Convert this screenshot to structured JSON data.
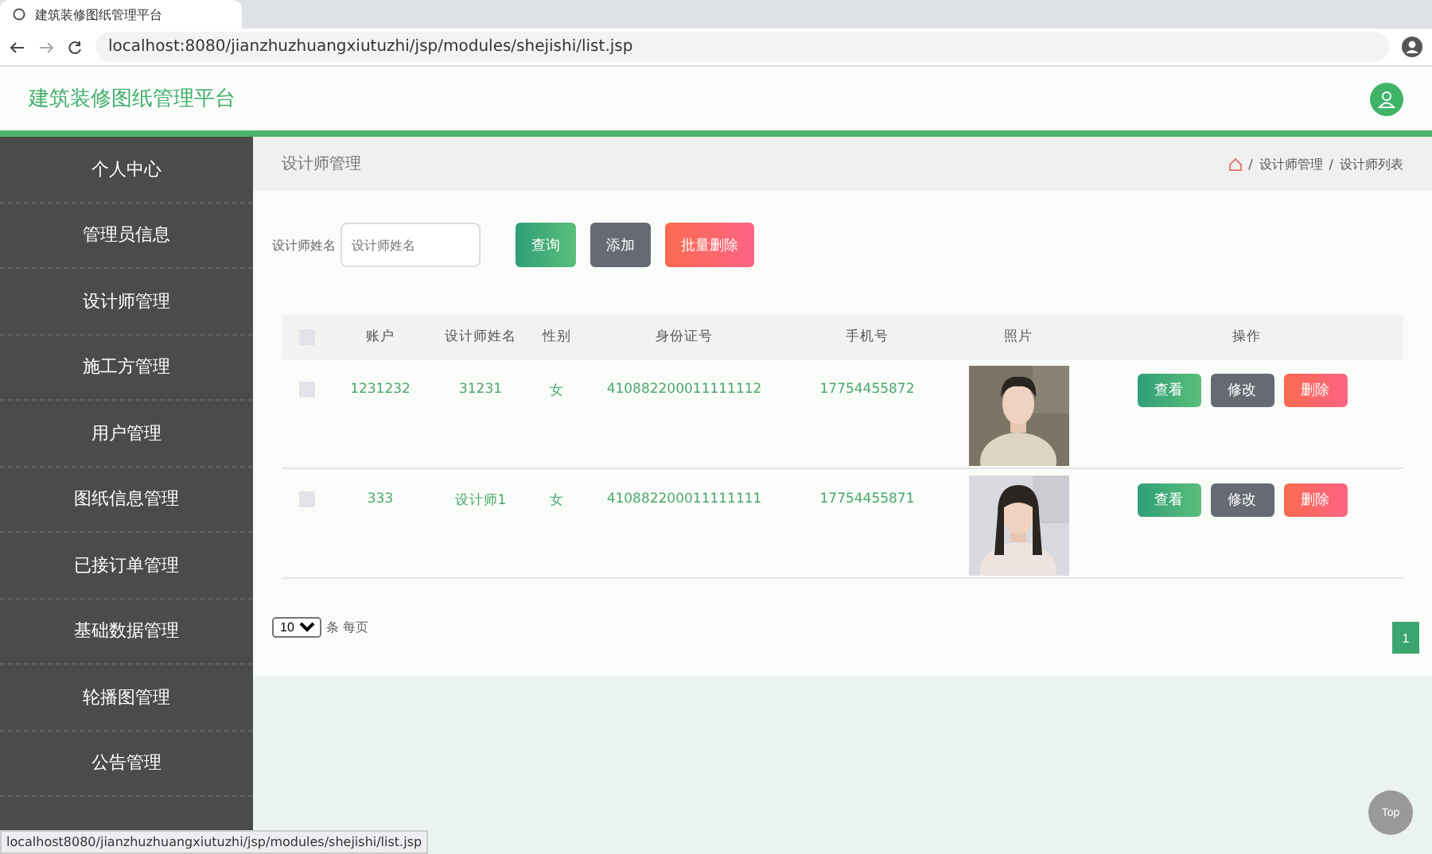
{
  "browser": {
    "tab_title": "建筑装修图纸管理平台",
    "url": "localhost:8080/jianzhuzhuangxiutuzhi/jsp/modules/shejishi/list.jsp",
    "status_url": "localhost8080/jianzhuzhuangxiutuzhi/jsp/modules/shejishi/list.jsp"
  },
  "header": {
    "title": "建筑装修图纸管理平台"
  },
  "sidebar": {
    "items": [
      {
        "label": "个人中心"
      },
      {
        "label": "管理员信息"
      },
      {
        "label": "设计师管理"
      },
      {
        "label": "施工方管理"
      },
      {
        "label": "用户管理"
      },
      {
        "label": "图纸信息管理"
      },
      {
        "label": "已接订单管理"
      },
      {
        "label": "基础数据管理"
      },
      {
        "label": "轮播图管理"
      },
      {
        "label": "公告管理"
      }
    ]
  },
  "page": {
    "title": "设计师管理",
    "breadcrumb": [
      "设计师管理",
      "设计师列表"
    ],
    "separator": "/"
  },
  "search": {
    "label": "设计师姓名",
    "placeholder": "设计师姓名"
  },
  "toolbar": [
    {
      "label": "查询",
      "kind": "primary"
    },
    {
      "label": "添加",
      "kind": "secondary"
    },
    {
      "label": "批量删除",
      "kind": "danger"
    }
  ],
  "table": {
    "header_checked": false,
    "columns": [
      "账户",
      "设计师姓名",
      "性别",
      "身份证号",
      "手机号",
      "照片",
      "操作"
    ],
    "rows": [
      {
        "checked": false,
        "cells": [
          "1231232",
          "31231",
          "女",
          "410882200011111112",
          "17754455872"
        ],
        "actions": [
          {
            "label": "查看",
            "kind": "primary"
          },
          {
            "label": "修改",
            "kind": "secondary"
          },
          {
            "label": "删除",
            "kind": "danger"
          }
        ]
      },
      {
        "checked": false,
        "cells": [
          "333",
          "设计师1",
          "女",
          "410882200011111111",
          "17754455871"
        ],
        "actions": [
          {
            "label": "查看",
            "kind": "primary"
          },
          {
            "label": "修改",
            "kind": "secondary"
          },
          {
            "label": "删除",
            "kind": "danger"
          }
        ]
      }
    ]
  },
  "pagination": {
    "page_size": "10",
    "page_size_label": "条 每页",
    "pages": [
      {
        "label": "1",
        "selected": true
      }
    ]
  },
  "top_button": "Top"
}
